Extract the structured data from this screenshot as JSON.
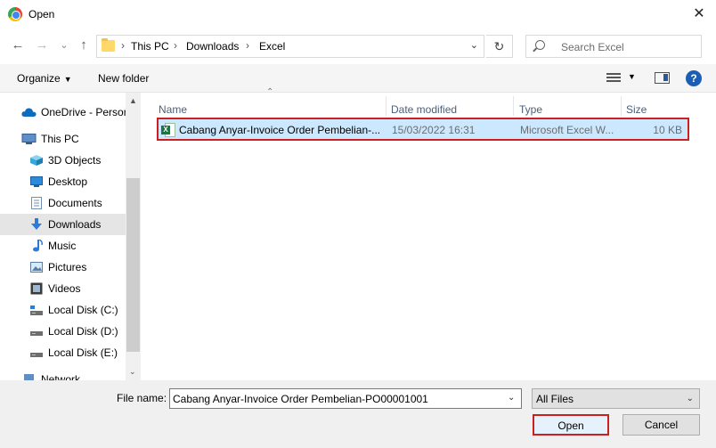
{
  "window": {
    "title": "Open",
    "close_label": "✕"
  },
  "nav": {
    "back_icon": "←",
    "forward_icon": "→",
    "recent_icon": "⌄",
    "up_icon": "↑",
    "breadcrumb": [
      "This PC",
      "Downloads",
      "Excel"
    ],
    "breadcrumb_sep": "›",
    "refresh_icon": "↻",
    "search_placeholder": "Search Excel"
  },
  "toolbar": {
    "organize_label": "Organize",
    "new_folder_label": "New folder",
    "help_label": "?"
  },
  "sidebar": {
    "items": [
      {
        "label": "OneDrive - Person"
      },
      {
        "label": "This PC"
      },
      {
        "label": "3D Objects"
      },
      {
        "label": "Desktop"
      },
      {
        "label": "Documents"
      },
      {
        "label": "Downloads"
      },
      {
        "label": "Music"
      },
      {
        "label": "Pictures"
      },
      {
        "label": "Videos"
      },
      {
        "label": "Local Disk (C:)"
      },
      {
        "label": "Local Disk (D:)"
      },
      {
        "label": "Local Disk (E:)"
      },
      {
        "label": "Network"
      }
    ],
    "selected_label": "Downloads"
  },
  "filelist": {
    "columns": [
      "Name",
      "Date modified",
      "Type",
      "Size"
    ],
    "files": [
      {
        "name": "Cabang Anyar-Invoice Order Pembelian-...",
        "date": "15/03/2022 16:31",
        "type": "Microsoft Excel W...",
        "size": "10 KB"
      }
    ]
  },
  "bottom": {
    "file_name_label": "File name:",
    "file_name_value": "Cabang Anyar-Invoice Order Pembelian-PO00001001",
    "filter_value": "All Files",
    "open_label": "Open",
    "cancel_label": "Cancel"
  },
  "colors": {
    "selection": "#cce8ff",
    "highlight_border": "#cc1f1f",
    "accent": "#1a5fb4"
  }
}
